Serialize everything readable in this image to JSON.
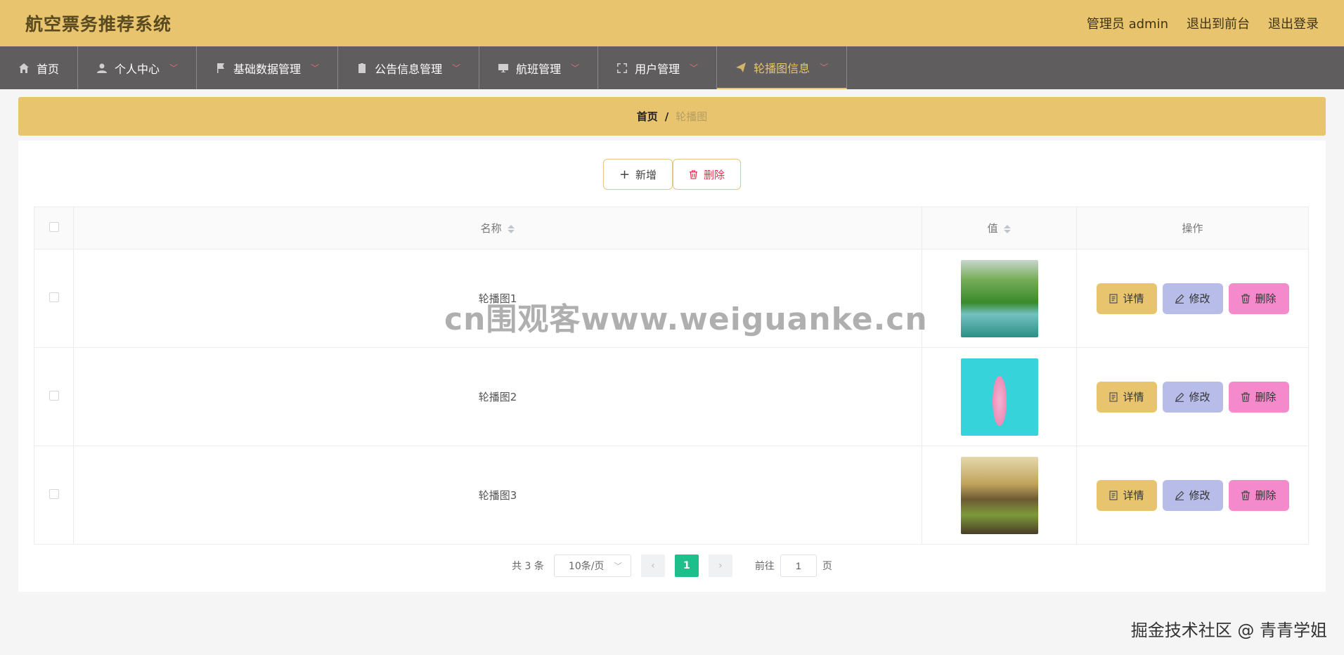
{
  "header": {
    "title": "航空票务推荐系统",
    "user_label": "管理员 admin",
    "front_link": "退出到前台",
    "logout_link": "退出登录"
  },
  "nav": {
    "items": [
      {
        "label": "首页",
        "icon": "home-icon"
      },
      {
        "label": "个人中心",
        "icon": "user-icon"
      },
      {
        "label": "基础数据管理",
        "icon": "flag-icon"
      },
      {
        "label": "公告信息管理",
        "icon": "clipboard-icon"
      },
      {
        "label": "航班管理",
        "icon": "monitor-icon"
      },
      {
        "label": "用户管理",
        "icon": "fullscreen-icon"
      },
      {
        "label": "轮播图信息",
        "icon": "send-icon"
      }
    ],
    "active_index": 6
  },
  "breadcrumb": {
    "home": "首页",
    "separator": "/",
    "current": "轮播图"
  },
  "toolbar": {
    "add_label": "新增",
    "delete_label": "删除"
  },
  "table": {
    "headers": {
      "name": "名称",
      "value": "值",
      "actions": "操作"
    },
    "rows": [
      {
        "name": "轮播图1",
        "image": "lake-landscape"
      },
      {
        "name": "轮播图2",
        "image": "pink-figure-on-cyan"
      },
      {
        "name": "轮播图3",
        "image": "golden-road-landscape"
      }
    ],
    "row_actions": {
      "detail": "详情",
      "edit": "修改",
      "delete": "删除"
    }
  },
  "pagination": {
    "total_text": "共 3 条",
    "page_size": "10条/页",
    "current_page": "1",
    "goto_label": "前往",
    "goto_value": "1",
    "page_suffix": "页"
  },
  "watermark": "cn围观客www.weiguanke.cn",
  "credit": "掘金技术社区 @ 青青学姐",
  "colors": {
    "header_bg": "#e8c46f",
    "nav_bg": "#5f5d5d",
    "detail_btn": "#e8c46f",
    "edit_btn": "#b7bde8",
    "delete_btn": "#f48acb",
    "page_active": "#1fbf8b"
  }
}
